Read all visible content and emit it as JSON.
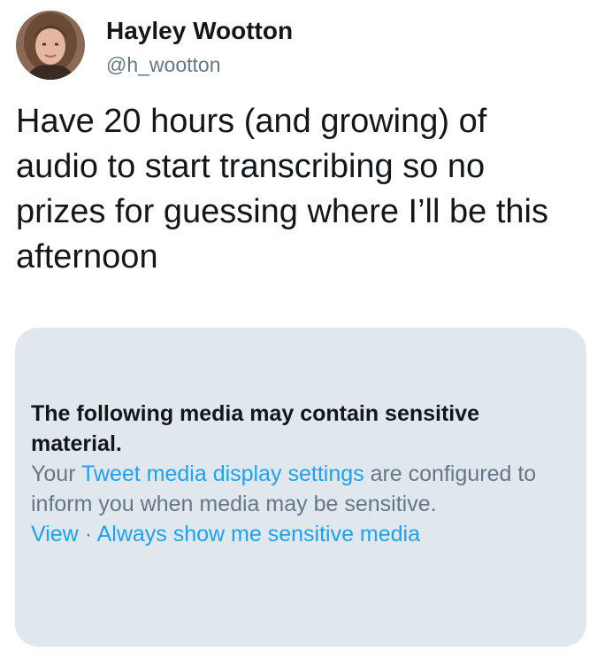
{
  "user": {
    "display_name": "Hayley Wootton",
    "handle": "@h_wootton",
    "avatar_icon": "profile-photo"
  },
  "tweet": {
    "text": "Have 20 hours (and growing) of\naudio to start transcribing so no\nprizes for guessing where I’ll be this\nafternoon"
  },
  "media_notice": {
    "title": "The following media may contain sensitive material.",
    "body_prefix": "Your ",
    "settings_link": "Tweet media display settings",
    "body_suffix": " are configured to inform you when media may be sensitive.",
    "view_link": "View",
    "separator": " · ",
    "always_show_link": "Always show me sensitive media"
  },
  "colors": {
    "text_primary": "#14171a",
    "text_secondary": "#657786",
    "link": "#1da1f2",
    "notice_background": "#e1e8ed"
  }
}
